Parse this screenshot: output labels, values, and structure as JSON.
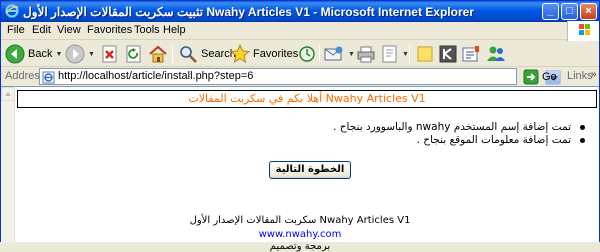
{
  "window": {
    "title": "تثبيت سكربت المقالات الإصدار الأول Nwahy Articles V1 - Microsoft Internet Explorer",
    "controls": {
      "minimize": "_",
      "maximize": "□",
      "close": "×"
    }
  },
  "menubar": {
    "items": [
      "File",
      "Edit",
      "View",
      "Favorites",
      "Tools",
      "Help"
    ]
  },
  "toolbar": {
    "back_label": "Back",
    "search_label": "Search",
    "favorites_label": "Favorites"
  },
  "addressbar": {
    "label": "Address",
    "url": "http://localhost/article/install.php?step=6",
    "go_label": "Go",
    "links_label": "Links"
  },
  "page": {
    "banner": "أهلا بكم في سكربت المقالات Nwahy Articles V1",
    "messages": [
      "تمت إضافة إسم المستخدم nwahy والباسوورد بنجاح .",
      "تمت إضافة معلومات الموقع بنجاح ."
    ],
    "next_button": "الخطوة التالية",
    "footer_title": "سكربت المقالات الإصدار الأول Nwahy Articles V1",
    "footer_link": "www.nwahy.com",
    "footer_credit": "برمجة وتصميم"
  },
  "colors": {
    "banner_text": "#ff6a00",
    "link": "#0000ff",
    "titlebar": "#0058e6"
  }
}
